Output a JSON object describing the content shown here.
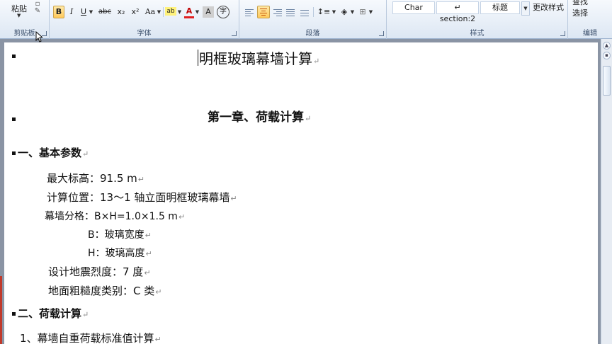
{
  "ribbon": {
    "clipboard": {
      "paste_label": "粘贴",
      "group_label": "剪贴板"
    },
    "font": {
      "group_label": "字体",
      "bold": "B",
      "italic": "I",
      "underline": "U",
      "strikethrough": "abc",
      "subscript": "x₂",
      "superscript": "x²",
      "change_case": "Aa",
      "highlight": "ab",
      "font_color": "A",
      "char_shading": "A",
      "enclose": "字"
    },
    "paragraph": {
      "group_label": "段落"
    },
    "styles": {
      "group_label": "样式",
      "items": [
        "Char",
        "↵ section:2",
        "标题"
      ],
      "change_styles_label": "更改样式"
    },
    "editing": {
      "group_label": "编辑",
      "find_label": "查找",
      "select_label": "选择"
    }
  },
  "document": {
    "title": "明框玻璃幕墙计算",
    "chapter": "第一章、荷载计算",
    "section1": "一、基本参数",
    "params": {
      "max_height": "最大标高：91.5 m",
      "location": "计算位置：13～1 轴立面明框玻璃幕墙",
      "grid": "幕墙分格：B×H=1.0×1.5 m",
      "b": "B：玻璃宽度",
      "h": "H：玻璃高度",
      "seismic": "设计地震烈度：7 度",
      "roughness": "地面粗糙度类别：C 类"
    },
    "section2": "二、荷载计算",
    "item1": "1、幕墙自重荷载标准值计算",
    "para_mark": "↵"
  }
}
